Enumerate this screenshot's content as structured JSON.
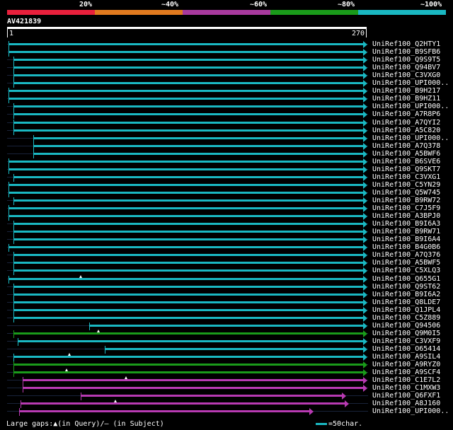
{
  "legend": {
    "labels": [
      "20%",
      "~40%",
      "~60%",
      "~80%",
      "~100%"
    ],
    "colors": [
      "#e8203c",
      "#e07a1f",
      "#a83a9e",
      "#1a9b1a",
      "#1ab8c2"
    ]
  },
  "query": {
    "name": "AV421839",
    "start": "1",
    "end": "270"
  },
  "colors": {
    "cyan": "#1ab8c2",
    "green": "#1a9b1a",
    "magenta": "#b83ab2",
    "thin": "#19233a",
    "gap": "#ffffff"
  },
  "hits": [
    {
      "label": "UniRef100_Q2HTY1",
      "color": "cyan",
      "start": 1,
      "end": 270,
      "arrow": true
    },
    {
      "label": "UniRef100_B9SFB6",
      "color": "cyan",
      "start": 1,
      "end": 270,
      "arrow": true
    },
    {
      "label": "UniRef100_Q9S9T5",
      "color": "cyan",
      "start": 5,
      "end": 270,
      "arrow": true
    },
    {
      "label": "UniRef100_Q94BV7",
      "color": "cyan",
      "start": 5,
      "end": 270,
      "arrow": true
    },
    {
      "label": "UniRef100_C3VXG0",
      "color": "cyan",
      "start": 5,
      "end": 270,
      "arrow": true
    },
    {
      "label": "UniRef100_UPI000..",
      "color": "cyan",
      "start": 5,
      "end": 270,
      "arrow": true
    },
    {
      "label": "UniRef100_B9H217",
      "color": "cyan",
      "start": 1,
      "end": 270,
      "arrow": true
    },
    {
      "label": "UniRef100_B9HZ11",
      "color": "cyan",
      "start": 1,
      "end": 270,
      "arrow": true
    },
    {
      "label": "UniRef100_UPI000..",
      "color": "cyan",
      "start": 5,
      "end": 270,
      "arrow": true
    },
    {
      "label": "UniRef100_A7R8P6",
      "color": "cyan",
      "start": 5,
      "end": 270,
      "arrow": true
    },
    {
      "label": "UniRef100_A7QYI2",
      "color": "cyan",
      "start": 5,
      "end": 270,
      "arrow": true
    },
    {
      "label": "UniRef100_A5C820",
      "color": "cyan",
      "start": 5,
      "end": 270,
      "arrow": true
    },
    {
      "label": "UniRef100_UPI000..",
      "color": "cyan",
      "start": 20,
      "end": 270,
      "arrow": true
    },
    {
      "label": "UniRef100_A7Q378",
      "color": "cyan",
      "start": 20,
      "end": 270,
      "arrow": true
    },
    {
      "label": "UniRef100_A5BWF6",
      "color": "cyan",
      "start": 20,
      "end": 270,
      "arrow": true
    },
    {
      "label": "UniRef100_B6SVE6",
      "color": "cyan",
      "start": 1,
      "end": 270,
      "arrow": true
    },
    {
      "label": "UniRef100_Q9SKT7",
      "color": "cyan",
      "start": 1,
      "end": 270,
      "arrow": true
    },
    {
      "label": "UniRef100_C3VXG1",
      "color": "cyan",
      "start": 5,
      "end": 270,
      "arrow": true
    },
    {
      "label": "UniRef100_C5YN29",
      "color": "cyan",
      "start": 1,
      "end": 270,
      "arrow": true
    },
    {
      "label": "UniRef100_Q5W745",
      "color": "cyan",
      "start": 1,
      "end": 270,
      "arrow": true
    },
    {
      "label": "UniRef100_B9RW72",
      "color": "cyan",
      "start": 5,
      "end": 270,
      "arrow": true
    },
    {
      "label": "UniRef100_C7J5F9",
      "color": "cyan",
      "start": 1,
      "end": 270,
      "arrow": true
    },
    {
      "label": "UniRef100_A3BPJ0",
      "color": "cyan",
      "start": 1,
      "end": 270,
      "arrow": true
    },
    {
      "label": "UniRef100_B9I6A3",
      "color": "cyan",
      "start": 5,
      "end": 270,
      "arrow": true
    },
    {
      "label": "UniRef100_B9RW71",
      "color": "cyan",
      "start": 5,
      "end": 270,
      "arrow": true
    },
    {
      "label": "UniRef100_B9I6A4",
      "color": "cyan",
      "start": 5,
      "end": 270,
      "arrow": true
    },
    {
      "label": "UniRef100_B4G0B6",
      "color": "cyan",
      "start": 1,
      "end": 270,
      "arrow": true
    },
    {
      "label": "UniRef100_A7Q376",
      "color": "cyan",
      "start": 5,
      "end": 270,
      "arrow": true
    },
    {
      "label": "UniRef100_A5BWF5",
      "color": "cyan",
      "start": 5,
      "end": 270,
      "arrow": true
    },
    {
      "label": "UniRef100_C5XLQ3",
      "color": "cyan",
      "start": 5,
      "end": 270,
      "arrow": true
    },
    {
      "label": "UniRef100_Q655G1",
      "color": "cyan",
      "start": 1,
      "end": 270,
      "arrow": true,
      "gap": 56
    },
    {
      "label": "UniRef100_Q9ST62",
      "color": "cyan",
      "start": 5,
      "end": 270,
      "arrow": true
    },
    {
      "label": "UniRef100_B9I6A2",
      "color": "cyan",
      "start": 5,
      "end": 270,
      "arrow": true
    },
    {
      "label": "UniRef100_Q8LDE7",
      "color": "cyan",
      "start": 5,
      "end": 270,
      "arrow": true
    },
    {
      "label": "UniRef100_Q1JPL4",
      "color": "cyan",
      "start": 5,
      "end": 270,
      "arrow": true
    },
    {
      "label": "UniRef100_C5Z889",
      "color": "cyan",
      "start": 5,
      "end": 270,
      "arrow": true
    },
    {
      "label": "UniRef100_Q94506",
      "color": "cyan",
      "start": 62,
      "end": 270,
      "arrow": true
    },
    {
      "label": "UniRef100_Q9M0I5",
      "color": "green",
      "start": 5,
      "end": 270,
      "arrow": true,
      "gap": 69
    },
    {
      "label": "UniRef100_C3VXF9",
      "color": "cyan",
      "start": 8,
      "end": 270,
      "arrow": true
    },
    {
      "label": "UniRef100_O65414",
      "color": "cyan",
      "start": 74,
      "end": 270,
      "arrow": true
    },
    {
      "label": "UniRef100_A9SIL4",
      "color": "cyan",
      "start": 5,
      "end": 270,
      "arrow": true,
      "gap": 47
    },
    {
      "label": "UniRef100_A9RYZ0",
      "color": "green",
      "start": 5,
      "end": 270,
      "arrow": true
    },
    {
      "label": "UniRef100_A9SCF4",
      "color": "green",
      "start": 5,
      "end": 270,
      "arrow": true,
      "gap": 45
    },
    {
      "label": "UniRef100_C1E7L2",
      "color": "magenta",
      "start": 12,
      "end": 270,
      "arrow": true,
      "gap": 90
    },
    {
      "label": "UniRef100_C1MXW3",
      "color": "magenta",
      "start": 12,
      "end": 270,
      "arrow": true
    },
    {
      "label": "UniRef100_Q6FXF1",
      "color": "magenta",
      "start": 56,
      "end": 254,
      "arrow": true
    },
    {
      "label": "UniRef100_A8J160",
      "color": "magenta",
      "start": 10,
      "end": 256,
      "arrow": true,
      "gap": 82
    },
    {
      "label": "UniRef100_UPI000..",
      "color": "magenta",
      "start": 9,
      "end": 229,
      "arrow": true
    }
  ],
  "footer": {
    "gaps_text": "Large gaps:▲(in Query)/– (in Subject)",
    "scale_text": "=50char."
  }
}
